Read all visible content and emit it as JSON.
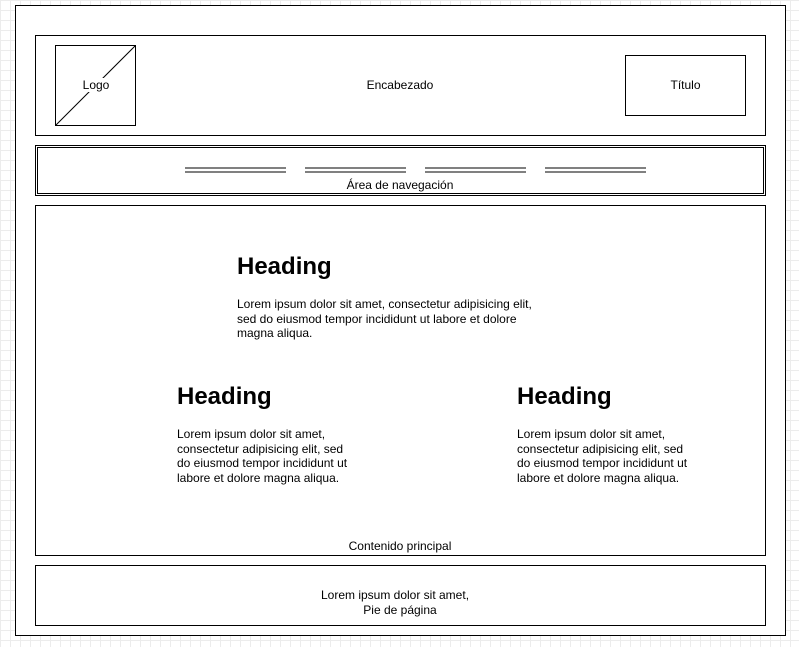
{
  "header": {
    "logo": "Logo",
    "label": "Encabezado",
    "title": "Título"
  },
  "nav": {
    "label": "Área de navegación",
    "items": 4
  },
  "main": {
    "label": "Contenido principal",
    "sections": [
      {
        "heading": "Heading",
        "text": "Lorem ipsum dolor sit amet, consectetur adipisicing elit, sed do eiusmod tempor incididunt ut labore et dolore magna aliqua."
      },
      {
        "heading": "Heading",
        "text": "Lorem ipsum dolor sit amet, consectetur adipisicing elit, sed do eiusmod tempor incididunt ut labore et dolore magna aliqua."
      },
      {
        "heading": "Heading",
        "text": "Lorem ipsum dolor sit amet, consectetur adipisicing elit, sed do eiusmod tempor incididunt ut labore et dolore magna aliqua."
      }
    ]
  },
  "footer": {
    "line1": "Lorem ipsum dolor sit amet,",
    "line2": "Pie de página"
  }
}
